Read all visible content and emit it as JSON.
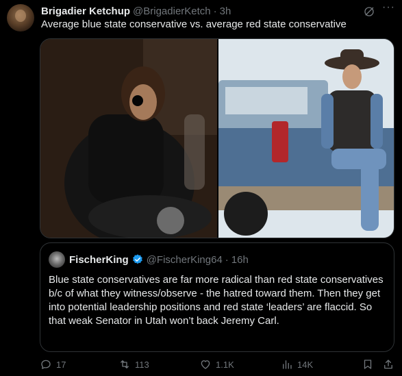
{
  "tweet": {
    "display_name": "Brigadier Ketchup",
    "handle": "@BrigadierKetch",
    "separator": "·",
    "time": "3h",
    "text": "Average blue state conservative vs. average red state conservative"
  },
  "quote": {
    "display_name": "FischerKing",
    "handle": "@FischerKing64",
    "separator": "·",
    "time": "16h",
    "text": "Blue state conservatives are far more radical than red state conservatives b/c of what they witness/observe - the hatred toward them. Then they get into potential leadership positions and red state ‘leaders’ are flaccid. So that weak Senator in Utah won’t back Jeremy Carl."
  },
  "actions": {
    "replies": "17",
    "reposts": "113",
    "likes": "1.1K",
    "views": "14K"
  },
  "icons": {
    "more": "more-icon",
    "grok": "grok-icon",
    "verified": "verified-badge-icon",
    "reply": "reply-icon",
    "repost": "repost-icon",
    "like": "heart-icon",
    "views": "views-icon",
    "bookmark": "bookmark-icon",
    "share": "share-icon"
  },
  "colors": {
    "background": "#000000",
    "text": "#e7e9ea",
    "secondary": "#71767b",
    "border": "#2f3336",
    "verified": "#1d9bf0"
  }
}
